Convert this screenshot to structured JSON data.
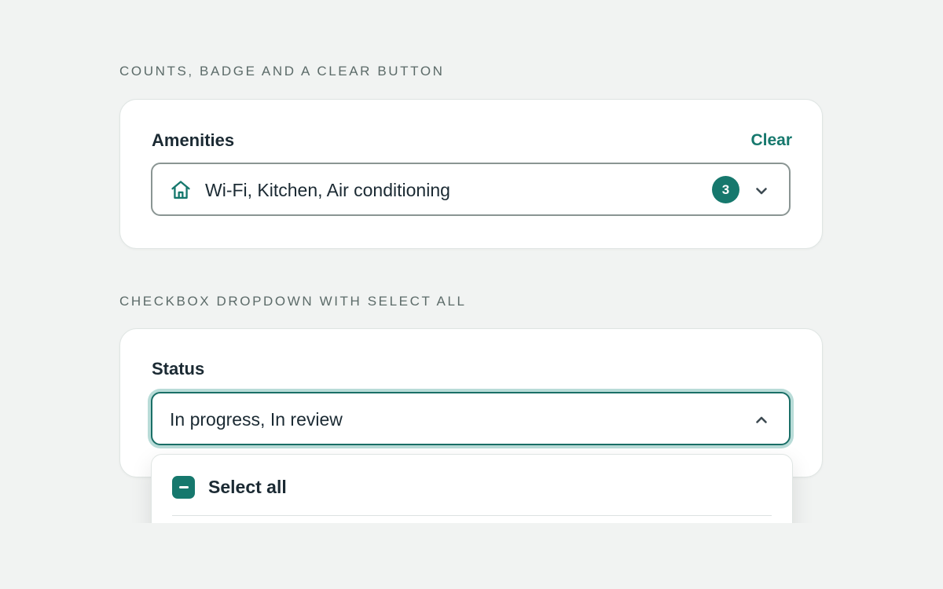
{
  "section1": {
    "heading": "COUNTS, BADGE AND A CLEAR BUTTON",
    "field_label": "Amenities",
    "clear_label": "Clear",
    "value": "Wi-Fi, Kitchen, Air conditioning",
    "count": "3",
    "icon": "home-icon"
  },
  "section2": {
    "heading": "CHECKBOX DROPDOWN WITH SELECT ALL",
    "field_label": "Status",
    "value": "In progress, In review",
    "dropdown": {
      "select_all_label": "Select all",
      "select_all_state": "indeterminate"
    }
  },
  "colors": {
    "accent": "#16786d",
    "background": "#f1f3f2",
    "focus_ring": "#b9dcd8"
  }
}
